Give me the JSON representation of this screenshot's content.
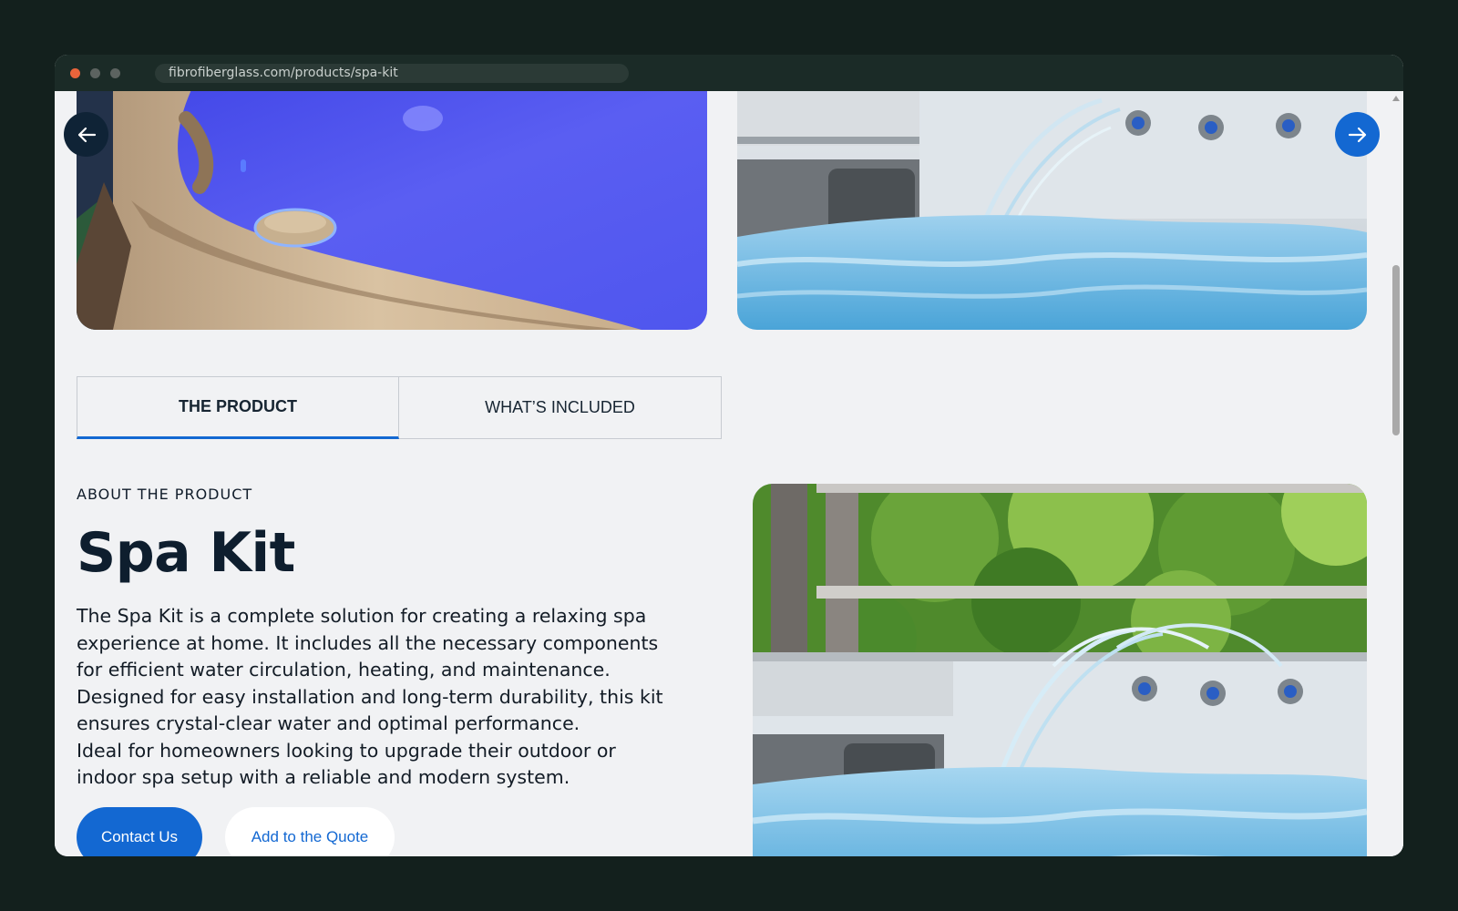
{
  "browser": {
    "url": "fibrofiberglass.com/products/spa-kit"
  },
  "gallery": {
    "prev_icon": "arrow-left-icon",
    "next_icon": "arrow-right-icon"
  },
  "tabs": [
    {
      "label": "THE PRODUCT",
      "active": true
    },
    {
      "label": "WHAT’S INCLUDED",
      "active": false
    }
  ],
  "product": {
    "eyebrow": "ABOUT THE PRODUCT",
    "title": "Spa Kit",
    "description": [
      "The Spa Kit is a complete solution for creating a relaxing spa",
      "experience at home. It includes all the necessary components",
      "for efficient water circulation, heating, and maintenance.",
      "Designed for easy installation and long-term durability, this kit",
      "ensures crystal-clear water and optimal performance.",
      "Ideal for homeowners looking to upgrade their outdoor or",
      "indoor spa setup with a reliable and modern system."
    ]
  },
  "actions": {
    "contact_label": "Contact Us",
    "quote_label": "Add to the Quote"
  },
  "colors": {
    "accent": "#1368d2",
    "dark": "#0f2336",
    "page_bg": "#f1f2f4"
  }
}
